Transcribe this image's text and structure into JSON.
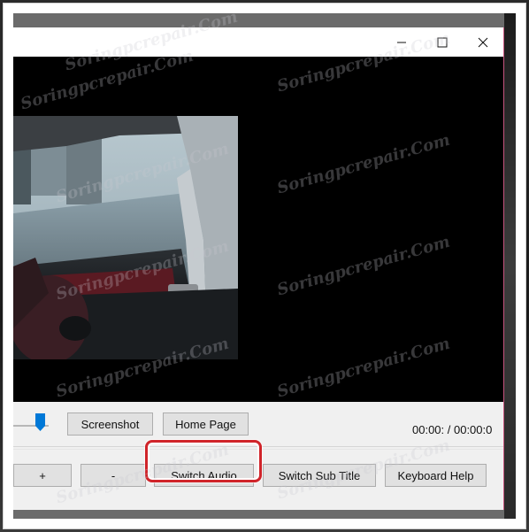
{
  "window": {
    "minimize_glyph": "—",
    "maximize_glyph": "☐",
    "close_glyph": "✕"
  },
  "toolbar": {
    "screenshot_label": "Screenshot",
    "home_page_label": "Home Page",
    "time_display": "00:00: / 00:00:0"
  },
  "playback": {
    "seek_position": 0.05
  },
  "bottom_buttons": {
    "plus_label": "+",
    "minus_label": "-",
    "switch_audio_label": "Switch Audio",
    "switch_subtitle_label": "Switch Sub Title",
    "keyboard_help_label": "Keyboard Help"
  },
  "watermark": {
    "text": "Soringpcrepair.Com"
  },
  "colors": {
    "highlight": "#d0242a",
    "slider_thumb": "#0078d7",
    "window_accent": "#c8557f"
  }
}
